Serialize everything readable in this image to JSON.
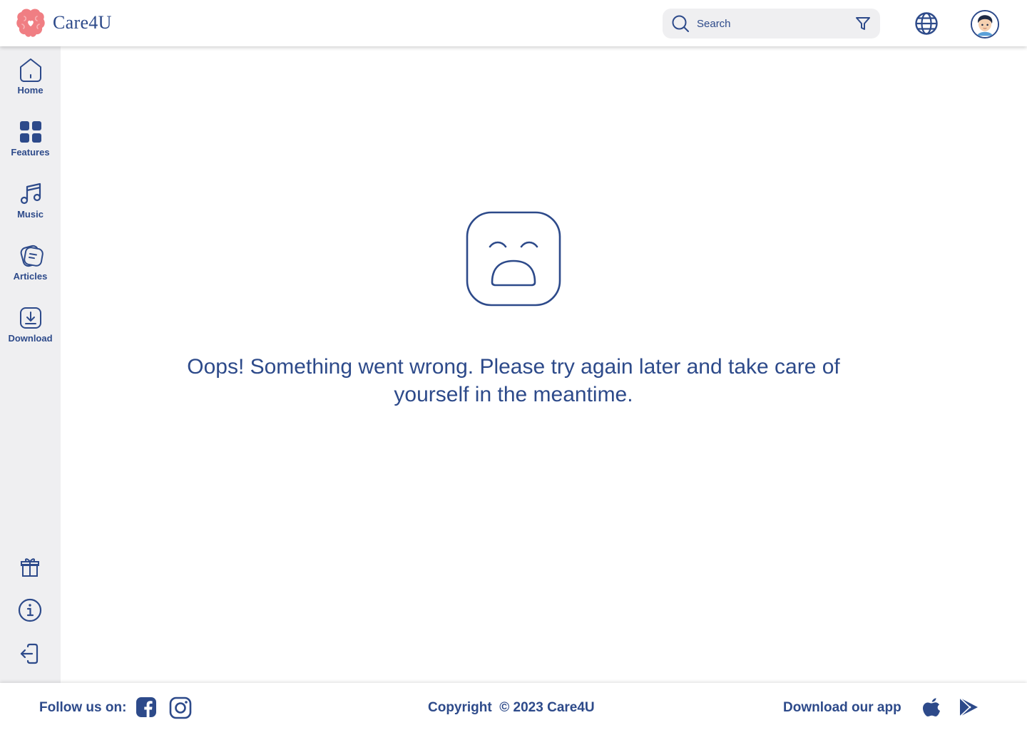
{
  "app": {
    "name": "Care4U"
  },
  "header": {
    "search_placeholder": "Search"
  },
  "sidebar": {
    "items": [
      {
        "label": "Home",
        "icon": "home-icon"
      },
      {
        "label": "Features",
        "icon": "grid-icon"
      },
      {
        "label": "Music",
        "icon": "music-note-icon"
      },
      {
        "label": "Articles",
        "icon": "articles-icon"
      },
      {
        "label": "Download",
        "icon": "download-icon"
      }
    ],
    "bottom_icons": [
      "gift-icon",
      "info-icon",
      "logout-icon"
    ]
  },
  "main": {
    "error_message": "Oops! Something went wrong. Please try again later and take care of yourself in the meantime.",
    "illustration_icon": "sad-face-icon"
  },
  "footer": {
    "follow_label": "Follow us on:",
    "copyright": "Copyright  © 2023 Care4U",
    "download_label": "Download our app",
    "social_icons": [
      "facebook-icon",
      "instagram-icon"
    ],
    "store_icons": [
      "apple-icon",
      "google-play-icon"
    ]
  },
  "colors": {
    "primary": "#2d4a8a",
    "brand_pink": "#f07e83",
    "sidebar_bg": "#efeff1",
    "background": "#ffffff"
  }
}
